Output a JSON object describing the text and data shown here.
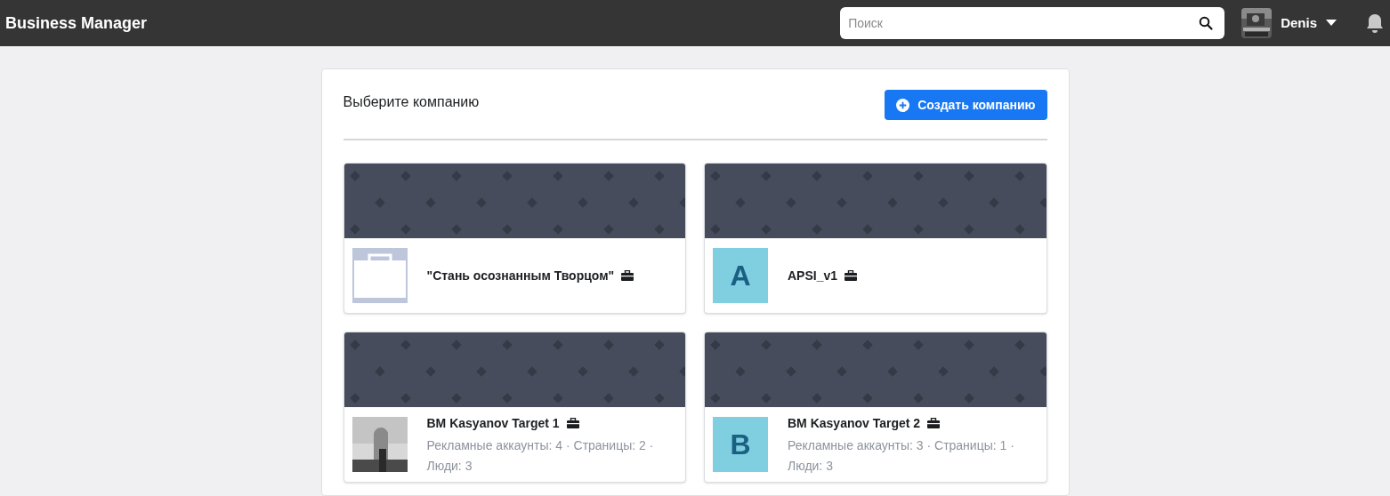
{
  "top_bar": {
    "title": "Business Manager",
    "search": {
      "placeholder": "Поиск"
    },
    "user": {
      "name": "Denis"
    }
  },
  "panel": {
    "heading": "Выберите компанию",
    "create_button": "Создать компанию",
    "companies": [
      {
        "kind": "briefcase",
        "name": "\"Стань осознанным Творцом\""
      },
      {
        "kind": "letter",
        "letter": "A",
        "name": "APSI_v1"
      },
      {
        "name": "BM Kasyanov Target 1",
        "stats": "Рекламные аккаунты: 4 · Страницы: 2 ·",
        "people": "Люди: 3"
      },
      {
        "kind": "letter",
        "letter": "B",
        "name": "BM Kasyanov Target 2",
        "stats": "Рекламные аккаунты: 3 · Страницы: 1 ·",
        "people": "Люди: 3"
      }
    ]
  }
}
